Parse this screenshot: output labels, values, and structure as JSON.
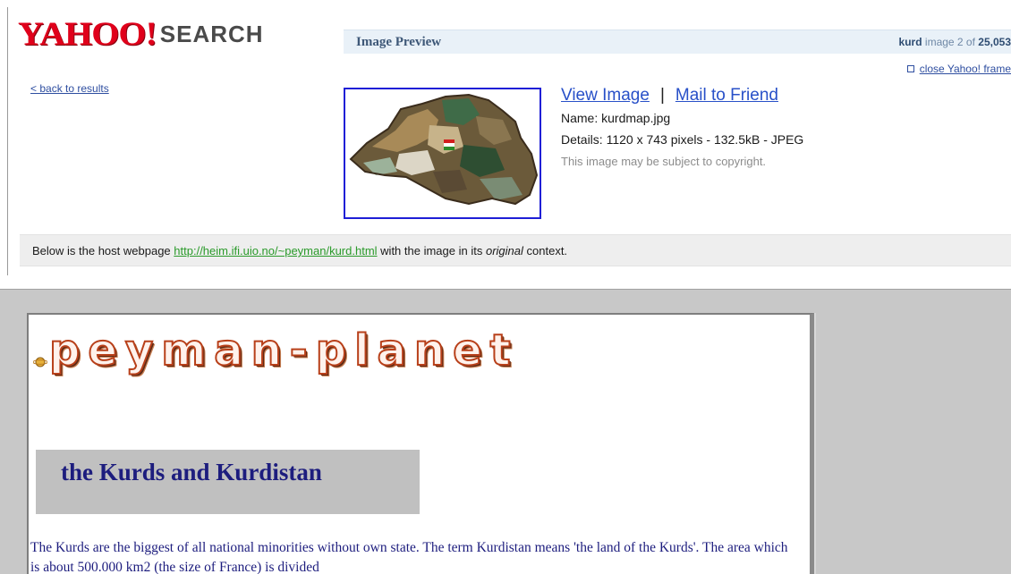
{
  "yahoo": {
    "logo_text": "YAHOO!",
    "logo_search": "SEARCH",
    "preview_title": "Image Preview",
    "query": "kurd",
    "count_text": "image 2 of",
    "count_total": "25,053",
    "close_frame": "close Yahoo! frame",
    "back_link": "< back to results",
    "view_image": "View Image",
    "separator": "|",
    "mail_friend": "Mail to Friend",
    "name_line": "Name: kurdmap.jpg",
    "details_line": "Details: 1120 x 743 pixels - 132.5kB - JPEG",
    "copyright_line": "This image may be subject to copyright.",
    "host_prefix": "Below is the host webpage",
    "host_url": "http://heim.ifi.uio.no/~peyman/kurd.html",
    "host_middle": "with the image in its",
    "host_italic": "original",
    "host_suffix": "context.",
    "colors": {
      "logo_red": "#e0001b",
      "link_blue": "#2850c8",
      "url_green": "#2a9a2a",
      "bar_blue": "#e9f1f8"
    }
  },
  "host_page": {
    "site_logo": "peyman-planet",
    "heading": "the Kurds and Kurdistan",
    "paragraph": "The Kurds are the biggest of all national minorities without own state. The term Kurdistan means 'the land of the Kurds'. The area which is about 500.000 km2 (the size of France) is divided",
    "colors": {
      "heading_blue": "#1d1d7e",
      "background_gray": "#c8c8c8"
    }
  },
  "icons": {
    "close_frame_icon": "checkbox-icon",
    "planet_icon": "small-planet-icon"
  }
}
